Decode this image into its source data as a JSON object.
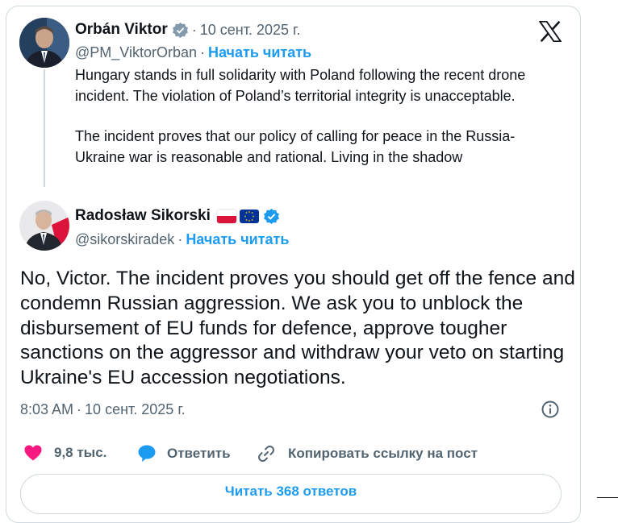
{
  "quoted_post": {
    "author_name": "Orbán Viktor",
    "date": "10 сент. 2025 г.",
    "handle": "@PM_ViktorOrban",
    "follow_label": "Начать читать",
    "paragraph_1": "Hungary stands in full solidarity with Poland following the recent drone incident. The violation of Poland’s territorial integrity is unacceptable.",
    "paragraph_2": "The incident proves that our policy of calling for peace in the Russia-Ukraine war is reasonable and rational. Living in the shadow"
  },
  "reply_post": {
    "author_name": "Radosław Sikorski",
    "handle": "@sikorskiradek",
    "follow_label": "Начать читать",
    "text": "No, Victor.  The incident proves you should get off the fence and condemn Russian aggression.  We ask you to unblock the disbursement of EU funds for defence, approve tougher sanctions on the aggressor and withdraw your veto on starting Ukraine's EU accession negotiations.",
    "time": "8:03 AM",
    "date": "10 сент. 2025 г."
  },
  "actions": {
    "likes": "9,8 тыс.",
    "reply_label": "Ответить",
    "copy_link_label": "Копировать ссылку на пост",
    "read_replies_label": "Читать 368 ответов"
  },
  "separator": "·",
  "icons": {
    "logo": "x-logo-icon",
    "verified": "verified-badge-icon",
    "info": "info-icon",
    "like": "heart-icon",
    "reply": "speech-bubble-icon",
    "copy": "link-icon"
  },
  "colors": {
    "accent": "#1d9bf0",
    "like": "#f91880",
    "muted": "#536471",
    "border": "#cfd9de"
  }
}
